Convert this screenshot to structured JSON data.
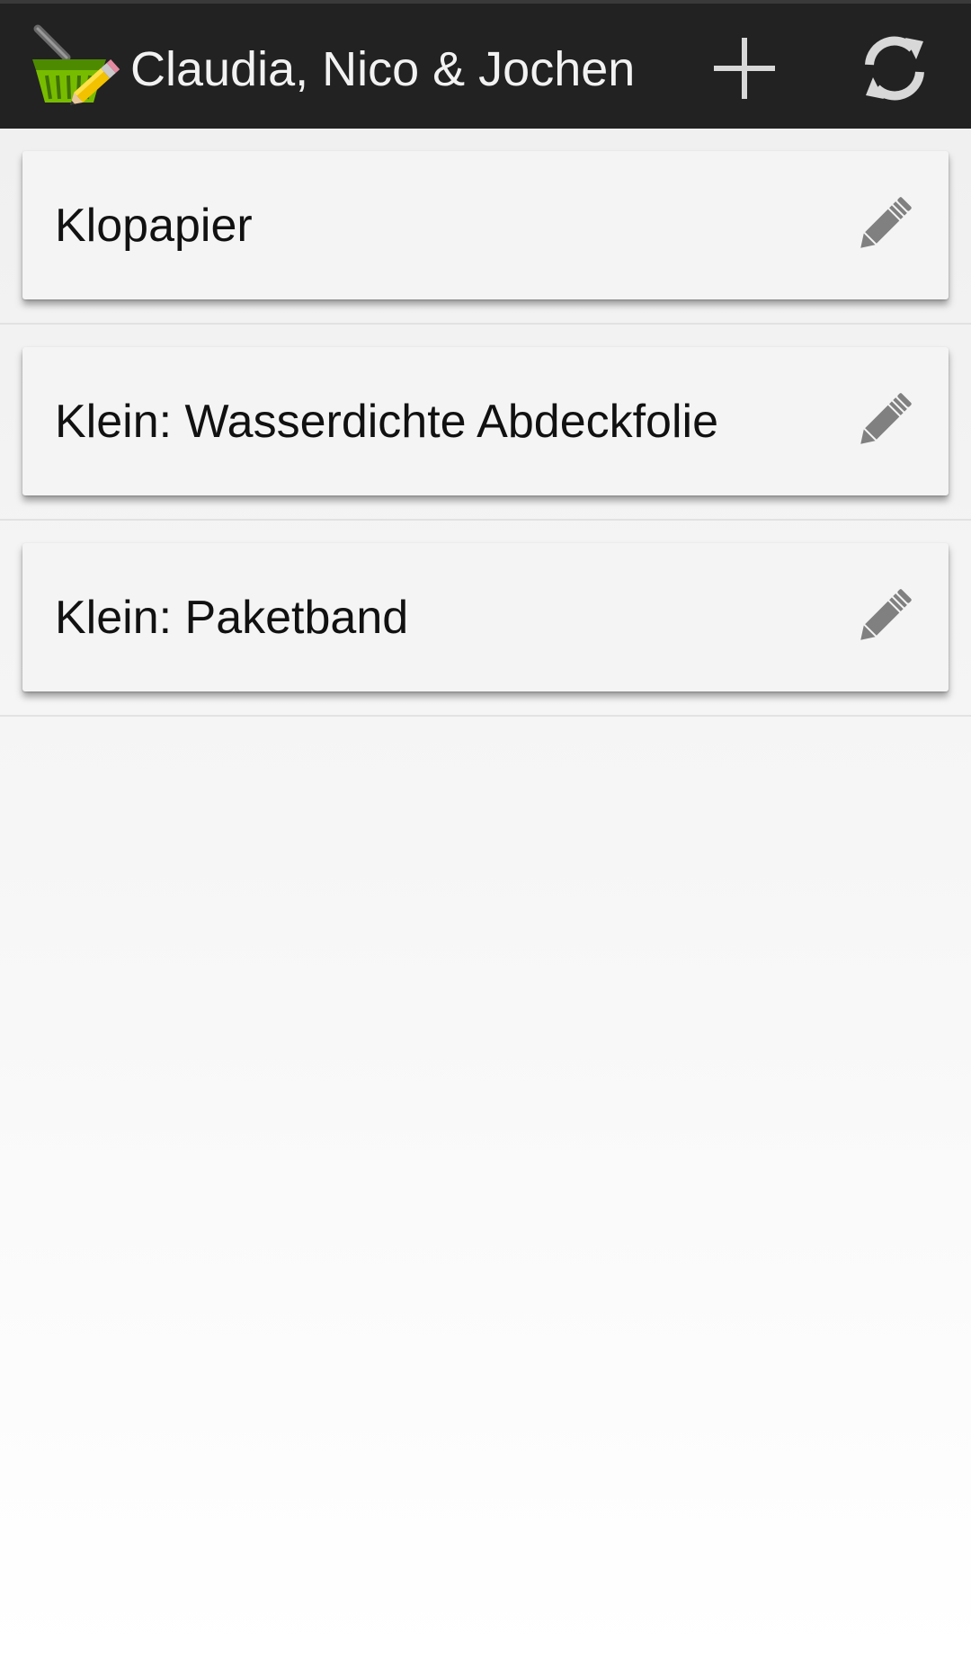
{
  "action_bar": {
    "title": "Claudia, Nico & Jochen",
    "app_icon": "shopping-basket-pencil-icon",
    "actions": [
      {
        "icon": "plus-icon"
      },
      {
        "icon": "refresh-icon"
      }
    ]
  },
  "items": [
    {
      "label": "Klopapier",
      "icon": "pencil-icon"
    },
    {
      "label": "Klein: Wasserdichte Abdeckfolie",
      "icon": "pencil-icon"
    },
    {
      "label": "Klein: Paketband",
      "icon": "pencil-icon"
    }
  ],
  "colors": {
    "action_bar_bg": "#222222",
    "title_text": "#f2f2f2",
    "card_bg": "#f4f4f4",
    "edit_icon": "#808080",
    "basket_green": "#6fb300"
  }
}
